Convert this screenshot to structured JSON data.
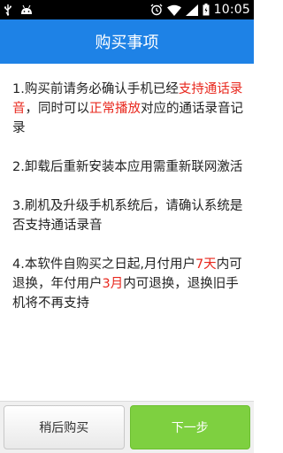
{
  "status_bar": {
    "left_icons": [
      "usb-icon",
      "android-icon"
    ],
    "right_icons": [
      "alarm-icon",
      "wifi-icon",
      "signal-icon",
      "battery-icon"
    ],
    "time": "10:05"
  },
  "header": {
    "title": "购买事项",
    "background": "#1e82e6"
  },
  "notes": [
    {
      "segments": [
        {
          "text": "1.购买前请务必确认手机已经",
          "highlight": false
        },
        {
          "text": "支持通话录音",
          "highlight": true
        },
        {
          "text": "，同时可以",
          "highlight": false
        },
        {
          "text": "正常播放",
          "highlight": true
        },
        {
          "text": "对应的通话录音记录",
          "highlight": false
        }
      ]
    },
    {
      "segments": [
        {
          "text": "2.卸载后重新安装本应用需重新联网激活",
          "highlight": false
        }
      ]
    },
    {
      "segments": [
        {
          "text": "3.刷机及升级手机系统后，请确认系统是否支持通话录音",
          "highlight": false
        }
      ]
    },
    {
      "segments": [
        {
          "text": "4.本软件自购买之日起,月付用户",
          "highlight": false
        },
        {
          "text": "7天",
          "highlight": true
        },
        {
          "text": "内可退换，年付用户",
          "highlight": false
        },
        {
          "text": "3月",
          "highlight": true
        },
        {
          "text": "内可退换，退换旧手机将不再支持",
          "highlight": false
        }
      ]
    }
  ],
  "highlight_color": "#e8281e",
  "buttons": {
    "later_label": "稍后购买",
    "next_label": "下一步",
    "next_color": "#7ed040"
  }
}
